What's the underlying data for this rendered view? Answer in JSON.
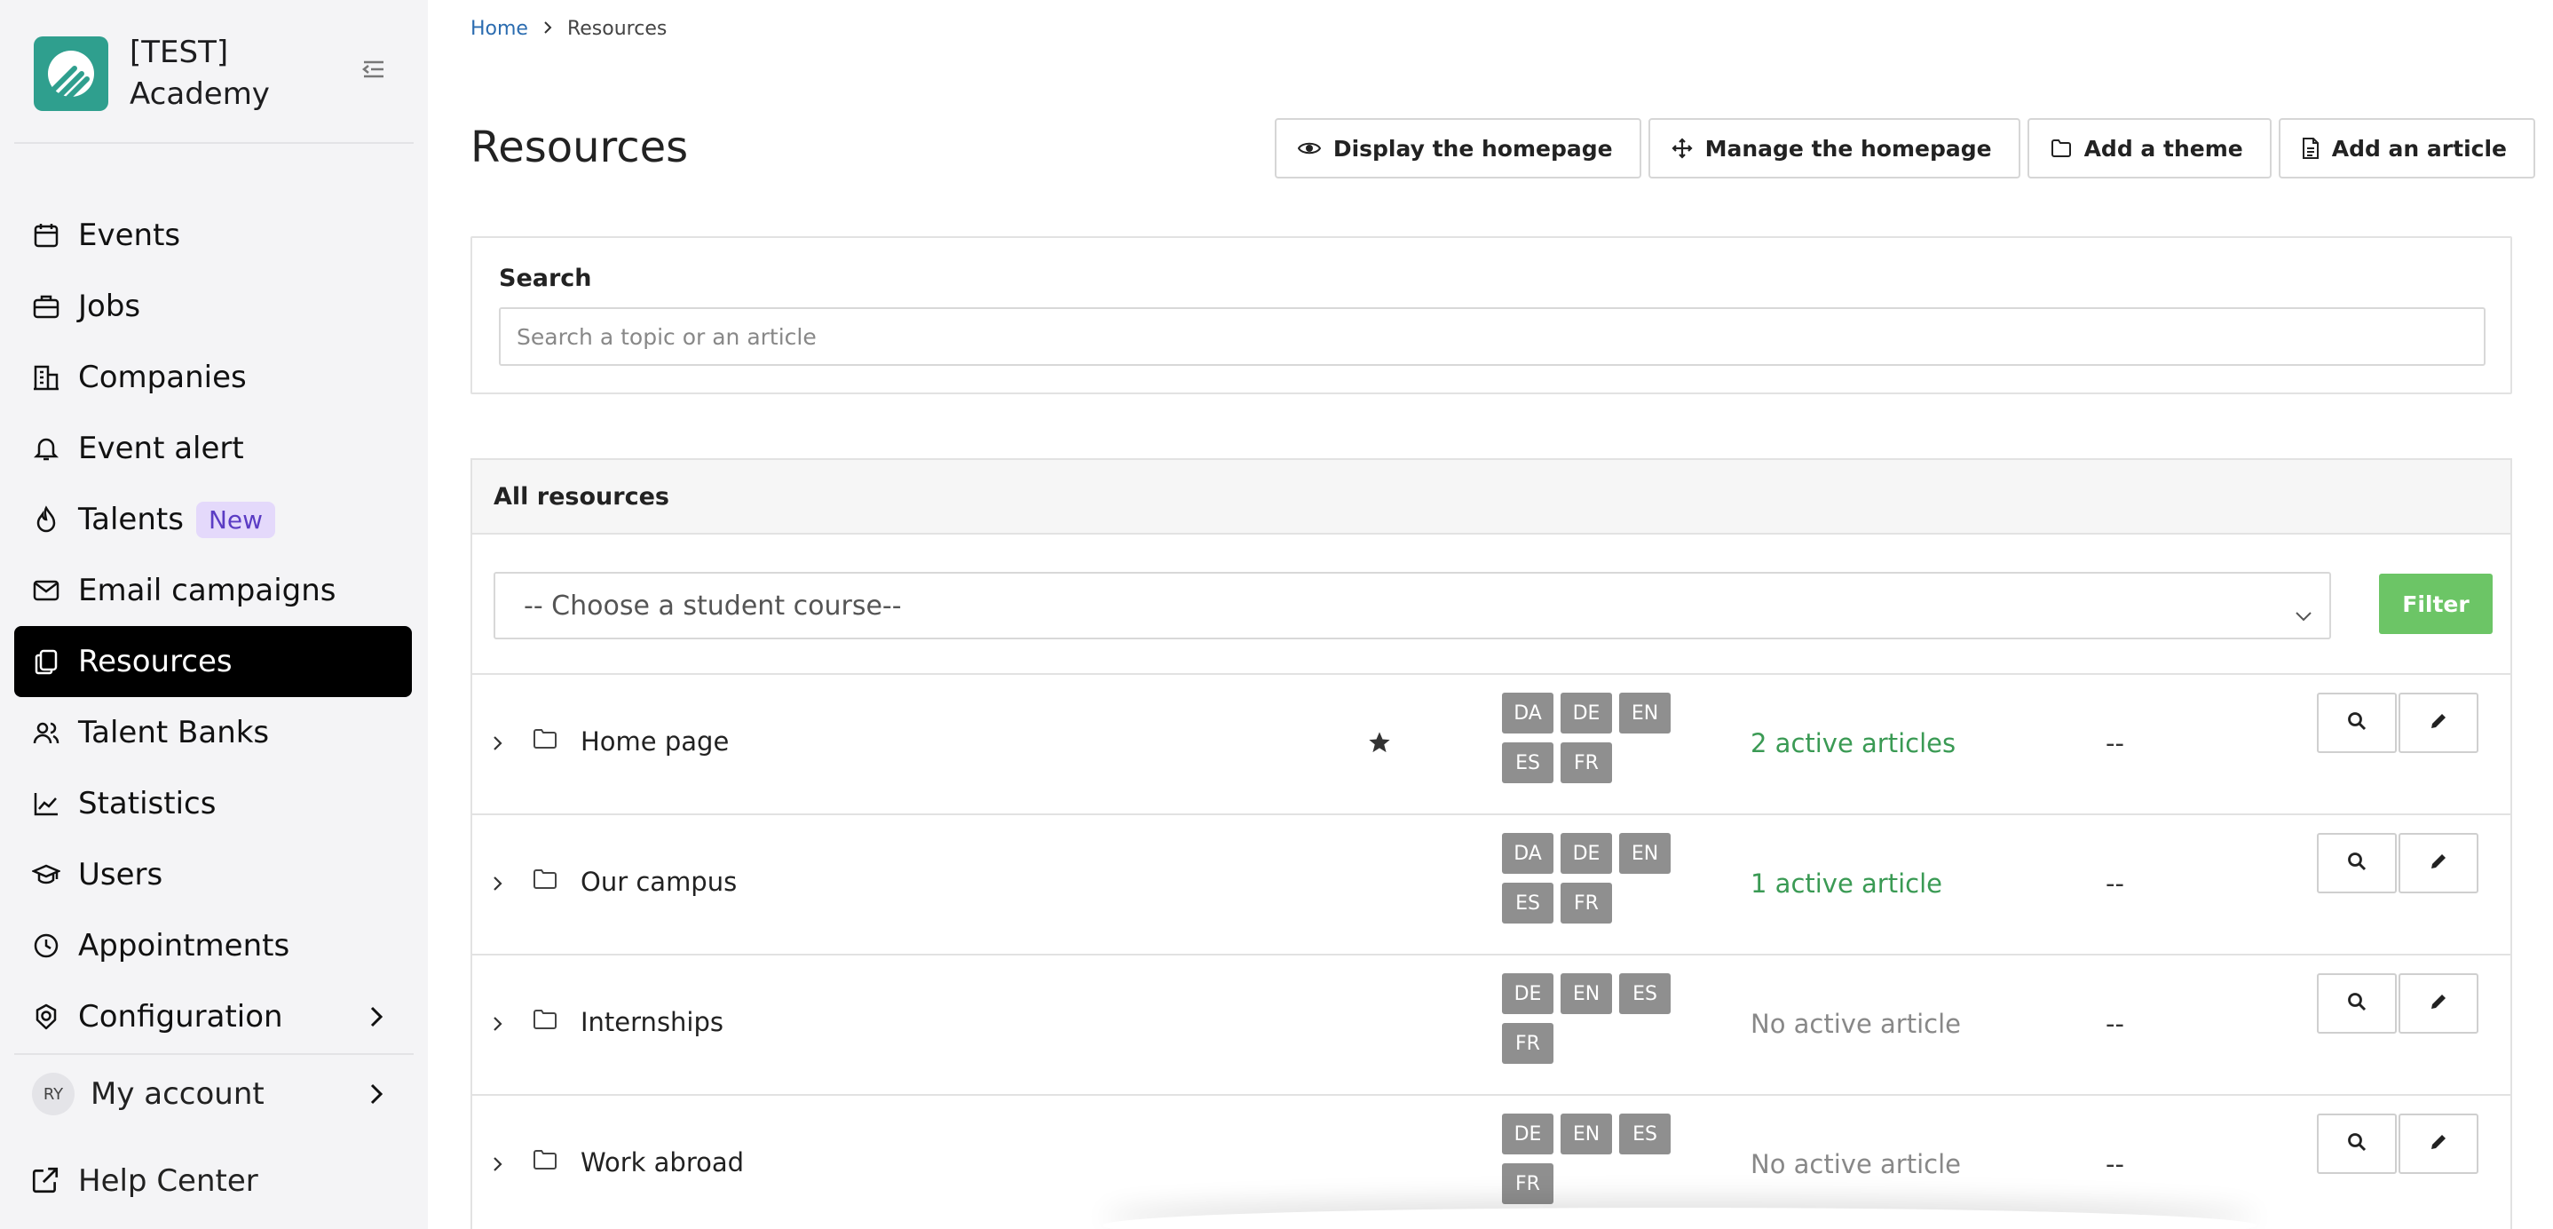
{
  "brand": {
    "name": "[TEST] Academy"
  },
  "sidebar": {
    "items": [
      {
        "label": "Events",
        "icon": "calendar-icon"
      },
      {
        "label": "Jobs",
        "icon": "briefcase-icon"
      },
      {
        "label": "Companies",
        "icon": "building-icon"
      },
      {
        "label": "Event alert",
        "icon": "bell-icon"
      },
      {
        "label": "Talents",
        "icon": "flame-icon",
        "badge": "New"
      },
      {
        "label": "Email campaigns",
        "icon": "mail-icon"
      },
      {
        "label": "Resources",
        "icon": "documents-icon",
        "active": true
      },
      {
        "label": "Talent Banks",
        "icon": "users-icon"
      },
      {
        "label": "Statistics",
        "icon": "chart-line-icon"
      },
      {
        "label": "Users",
        "icon": "graduation-cap-icon"
      },
      {
        "label": "Appointments",
        "icon": "clock-icon"
      },
      {
        "label": "Configuration",
        "icon": "settings-icon"
      }
    ],
    "account": {
      "initials": "RY",
      "label": "My account"
    },
    "help": {
      "label": "Help Center"
    }
  },
  "breadcrumb": {
    "home": "Home",
    "current": "Resources"
  },
  "page": {
    "title": "Resources"
  },
  "toolbar": {
    "display_homepage": "Display the homepage",
    "manage_homepage": "Manage the homepage",
    "add_theme": "Add a theme",
    "add_article": "Add an article"
  },
  "search": {
    "label": "Search",
    "placeholder": "Search a topic or an article"
  },
  "resources": {
    "header": "All resources",
    "course_select": "-- Choose a student course--",
    "filter_label": "Filter",
    "rows": [
      {
        "name": "Home page",
        "starred": true,
        "languages": [
          "DA",
          "DE",
          "EN",
          "ES",
          "FR"
        ],
        "status": "2 active articles",
        "status_active": true,
        "extra": "--"
      },
      {
        "name": "Our campus",
        "starred": false,
        "languages": [
          "DA",
          "DE",
          "EN",
          "ES",
          "FR"
        ],
        "status": "1 active article",
        "status_active": true,
        "extra": "--"
      },
      {
        "name": "Internships",
        "starred": false,
        "languages": [
          "DE",
          "EN",
          "ES",
          "FR"
        ],
        "status": "No active article",
        "status_active": false,
        "extra": "--"
      },
      {
        "name": "Work abroad",
        "starred": false,
        "languages": [
          "DE",
          "EN",
          "ES",
          "FR"
        ],
        "status": "No active article",
        "status_active": false,
        "extra": "--"
      }
    ]
  },
  "colors": {
    "brand": "#2f9f8e",
    "active_nav": "#000000",
    "status_active": "#3a9a54",
    "filter_button": "#6cc566",
    "language_tag": "#8f8f8f",
    "link": "#2b6cb0"
  }
}
